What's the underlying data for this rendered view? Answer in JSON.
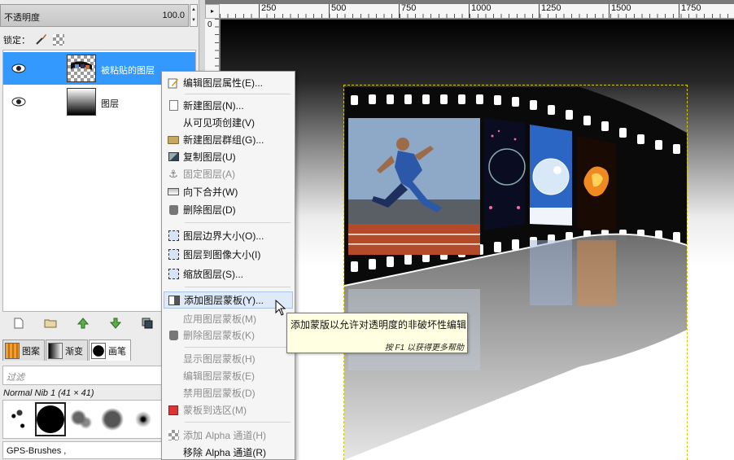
{
  "layers_panel": {
    "opacity_label": "不透明度",
    "opacity_value": "100.0",
    "lock_label": "锁定：",
    "layers": [
      {
        "name": "被粘贴的图层",
        "selected": true,
        "visible_icon": "eye-icon"
      },
      {
        "name": "图层",
        "selected": false,
        "visible_icon": "eye-icon"
      }
    ],
    "toolbar_icons": [
      "new-layer-icon",
      "new-group-icon",
      "raise-icon",
      "lower-icon",
      "duplicate-icon",
      "anchor-icon"
    ]
  },
  "brushes_panel": {
    "tabs": [
      {
        "label": "图案",
        "icon": "pattern-icon"
      },
      {
        "label": "渐变",
        "icon": "gradient-icon"
      },
      {
        "label": "画笔",
        "icon": "brush-icon"
      }
    ],
    "filter_placeholder": "过滤",
    "brush_name": "Normal Nib 1 (41 × 41)",
    "tags_value": "GPS-Brushes ,"
  },
  "canvas": {
    "ruler_corner": "▸",
    "ruler_vertical_label": "0",
    "ruler_marks": [
      "250",
      "500",
      "750",
      "1000",
      "1250",
      "1500",
      "1750"
    ]
  },
  "context_menu": {
    "items": [
      {
        "label": "编辑图层属性(E)...",
        "icon": "edit-icon",
        "enabled": true
      },
      {
        "label": "新建图层(N)...",
        "icon": "new-layer-icon",
        "enabled": true
      },
      {
        "label": "从可见项创建(V)",
        "icon": "",
        "enabled": true
      },
      {
        "label": "新建图层群组(G)...",
        "icon": "folder-icon",
        "enabled": true
      },
      {
        "label": "复制图层(U)",
        "icon": "duplicate-icon",
        "enabled": true
      },
      {
        "label": "固定图层(A)",
        "icon": "anchor-icon",
        "enabled": false
      },
      {
        "label": "向下合并(W)",
        "icon": "merge-down-icon",
        "enabled": true
      },
      {
        "label": "删除图层(D)",
        "icon": "trash-icon",
        "enabled": true
      },
      {
        "label": "图层边界大小(O)...",
        "icon": "layer-boundary-icon",
        "enabled": true
      },
      {
        "label": "图层到图像大小(I)",
        "icon": "layer-to-image-icon",
        "enabled": true
      },
      {
        "label": "缩放图层(S)...",
        "icon": "scale-layer-icon",
        "enabled": true
      },
      {
        "label": "添加图层蒙板(Y)...",
        "icon": "add-mask-icon",
        "enabled": true,
        "highlighted": true
      },
      {
        "label": "应用图层蒙板(M)",
        "icon": "",
        "enabled": false
      },
      {
        "label": "删除图层蒙板(K)",
        "icon": "trash-icon",
        "enabled": false
      },
      {
        "label": "显示图层蒙板(H)",
        "icon": "",
        "enabled": false
      },
      {
        "label": "编辑图层蒙板(E)",
        "icon": "",
        "enabled": false
      },
      {
        "label": "禁用图层蒙板(D)",
        "icon": "",
        "enabled": false
      },
      {
        "label": "蒙板到选区(M)",
        "icon": "mask-to-selection-icon",
        "enabled": false
      },
      {
        "label": "添加 Alpha 通道(H)",
        "icon": "alpha-icon",
        "enabled": false
      },
      {
        "label": "移除 Alpha 通道(R)",
        "icon": "",
        "enabled": true
      }
    ]
  },
  "tooltip": {
    "text": "添加蒙版以允许对透明度的非破坏性编辑",
    "hint": "按 F1 以获得更多帮助"
  },
  "colors": {
    "selection_blue": "#3399ff",
    "menu_highlight": "#dfeaf8",
    "tooltip_bg": "#ffffe1",
    "layer_boundary": "#d4c800"
  }
}
